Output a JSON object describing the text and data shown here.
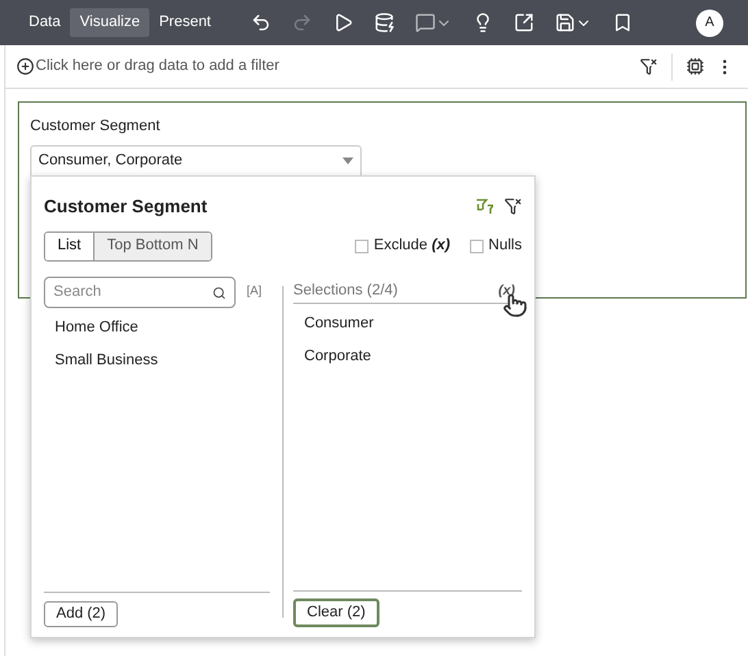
{
  "toolbar": {
    "tabs": [
      {
        "label": "Data",
        "selected": false
      },
      {
        "label": "Visualize",
        "selected": true
      },
      {
        "label": "Present",
        "selected": false
      }
    ],
    "avatar": "A"
  },
  "filter_bar": {
    "placeholder": "Click here or drag data to add a filter"
  },
  "filter": {
    "label": "Customer Segment",
    "value": "Consumer, Corporate"
  },
  "popup": {
    "title": "Customer Segment",
    "modes": [
      {
        "label": "List",
        "selected": true
      },
      {
        "label": "Top Bottom N",
        "selected": false
      }
    ],
    "exclude": {
      "label": "Exclude",
      "expr": "(x)",
      "checked": false
    },
    "nulls": {
      "label": "Nulls",
      "checked": false
    },
    "search": {
      "placeholder": "Search"
    },
    "case_toggle": "[A]",
    "available": [
      "Home Office",
      "Small Business"
    ],
    "add_button": "Add (2)",
    "selections_header": "Selections (2/4)",
    "selections_expr": "(x)",
    "selections": [
      "Consumer",
      "Corporate"
    ],
    "clear_button": "Clear (2)"
  }
}
